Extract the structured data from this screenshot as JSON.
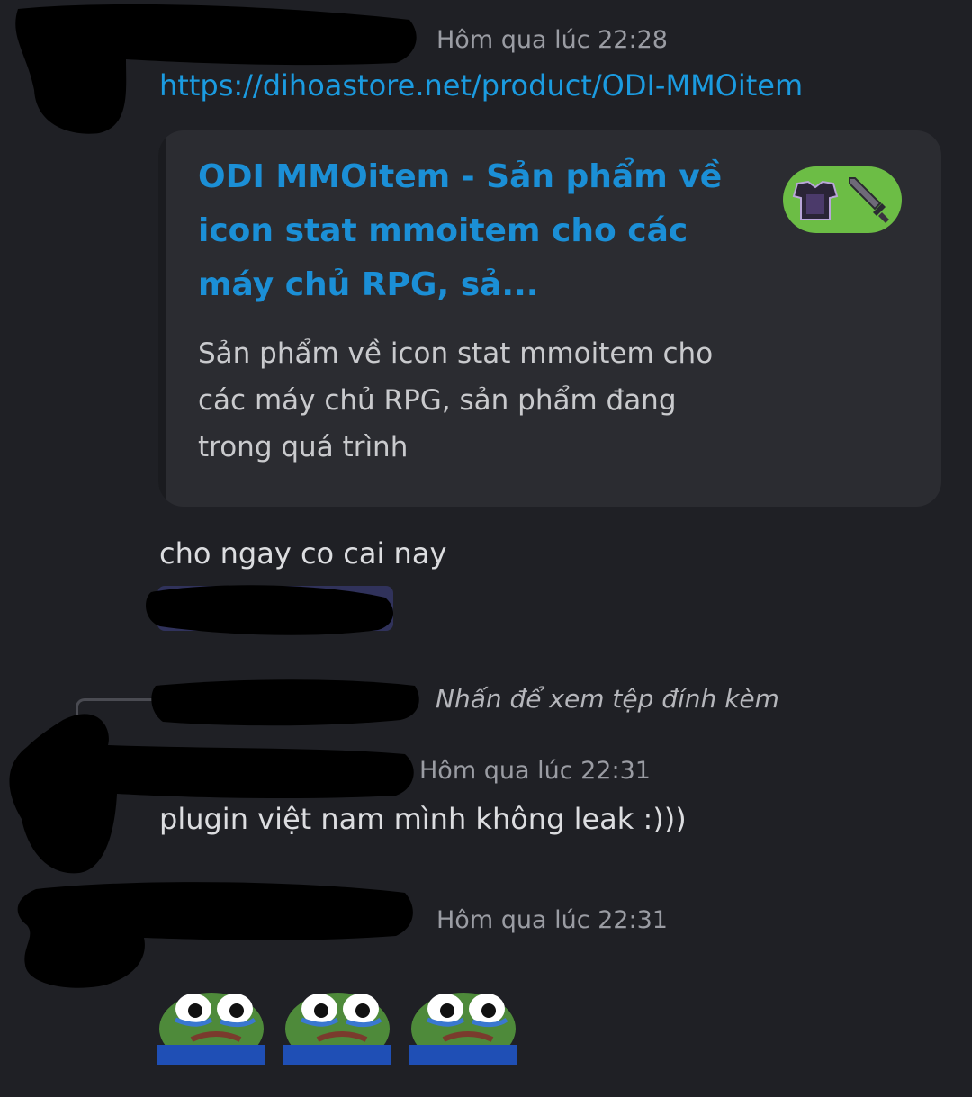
{
  "messages": [
    {
      "timestamp": "Hôm qua lúc 22:28",
      "link": "https://dihoastore.net/product/ODI-MMOitem",
      "embed": {
        "title": "ODI MMOitem - Sản phẩm về icon stat mmoitem cho các máy chủ RPG, sả...",
        "description": "Sản phẩm về icon stat mmoitem cho các máy chủ RPG, sản phẩm đang trong quá trình",
        "thumbnail_icons": [
          "chestplate-icon",
          "sword-icon"
        ],
        "thumbnail_bg": "#6cbd45"
      },
      "text": "cho ngay co cai nay"
    },
    {
      "reply_preview": "Nhấn để xem tệp đính kèm",
      "timestamp": "Hôm qua lúc 22:31",
      "text": "plugin việt nam mình không leak :)))"
    },
    {
      "timestamp": "Hôm qua lúc 22:31",
      "emojis": [
        "crying-frog-emoji",
        "crying-frog-emoji",
        "crying-frog-emoji"
      ]
    }
  ],
  "colors": {
    "background": "#1f2025",
    "link": "#1b9be0",
    "embed_bg": "#2b2c31",
    "timestamp": "#9a9ca3"
  }
}
